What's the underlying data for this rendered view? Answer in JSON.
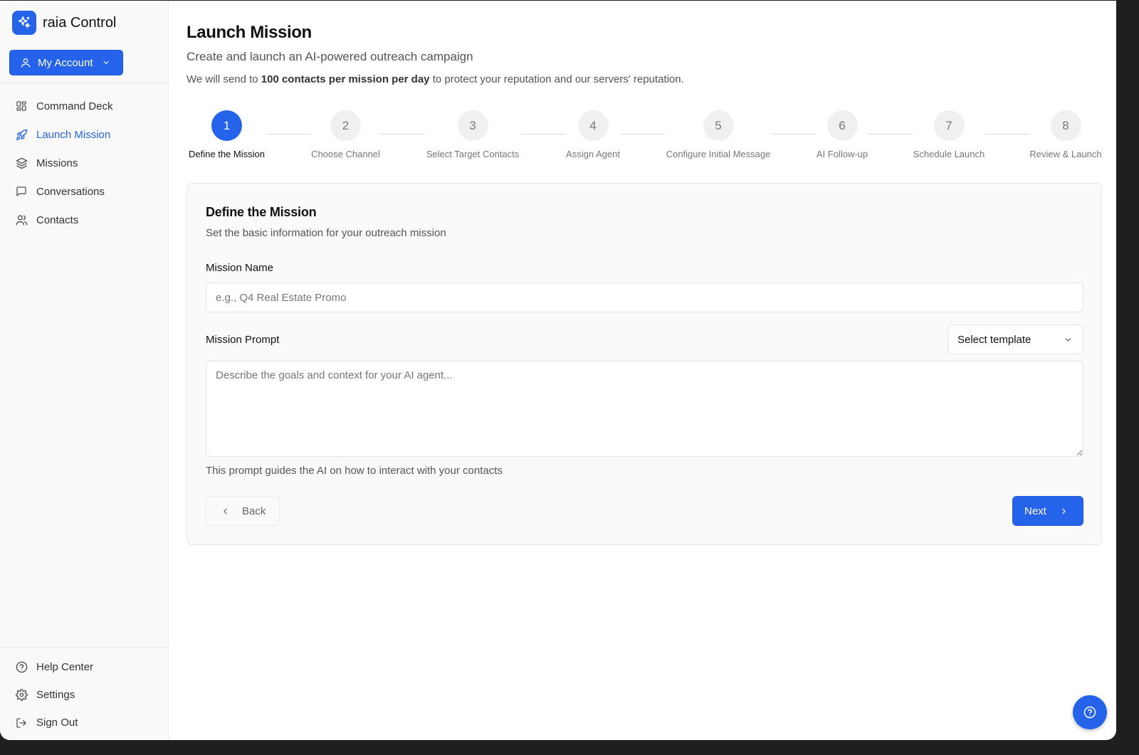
{
  "app": {
    "name": "raia Control",
    "accent": "#2563eb"
  },
  "account": {
    "label": "My Account"
  },
  "sidebar": {
    "items": [
      {
        "label": "Command Deck",
        "icon": "grid-icon",
        "active": false
      },
      {
        "label": "Launch Mission",
        "icon": "rocket-icon",
        "active": true
      },
      {
        "label": "Missions",
        "icon": "layers-icon",
        "active": false
      },
      {
        "label": "Conversations",
        "icon": "message-square-icon",
        "active": false
      },
      {
        "label": "Contacts",
        "icon": "users-icon",
        "active": false
      }
    ],
    "footer": [
      {
        "label": "Help Center",
        "icon": "help-circle-icon"
      },
      {
        "label": "Settings",
        "icon": "gear-icon"
      },
      {
        "label": "Sign Out",
        "icon": "log-out-icon"
      }
    ]
  },
  "page": {
    "title": "Launch Mission",
    "subtitle": "Create and launch an AI-powered outreach campaign",
    "note_prefix": "We will send to ",
    "note_bold": "100 contacts per mission per day",
    "note_suffix": " to protect your reputation and our servers' reputation."
  },
  "steps": [
    {
      "number": "1",
      "label": "Define the Mission",
      "active": true
    },
    {
      "number": "2",
      "label": "Choose Channel",
      "active": false
    },
    {
      "number": "3",
      "label": "Select Target Contacts",
      "active": false
    },
    {
      "number": "4",
      "label": "Assign Agent",
      "active": false
    },
    {
      "number": "5",
      "label": "Configure Initial Message",
      "active": false
    },
    {
      "number": "6",
      "label": "AI Follow-up",
      "active": false
    },
    {
      "number": "7",
      "label": "Schedule Launch",
      "active": false
    },
    {
      "number": "8",
      "label": "Review & Launch",
      "active": false
    }
  ],
  "form": {
    "title": "Define the Mission",
    "description": "Set the basic information for your outreach mission",
    "name_label": "Mission Name",
    "name_placeholder": "e.g., Q4 Real Estate Promo",
    "name_value": "",
    "prompt_label": "Mission Prompt",
    "template_select": "Select template",
    "prompt_placeholder": "Describe the goals and context for your AI agent...",
    "prompt_value": "",
    "hint": "This prompt guides the AI on how to interact with your contacts",
    "back_label": "Back",
    "next_label": "Next"
  }
}
